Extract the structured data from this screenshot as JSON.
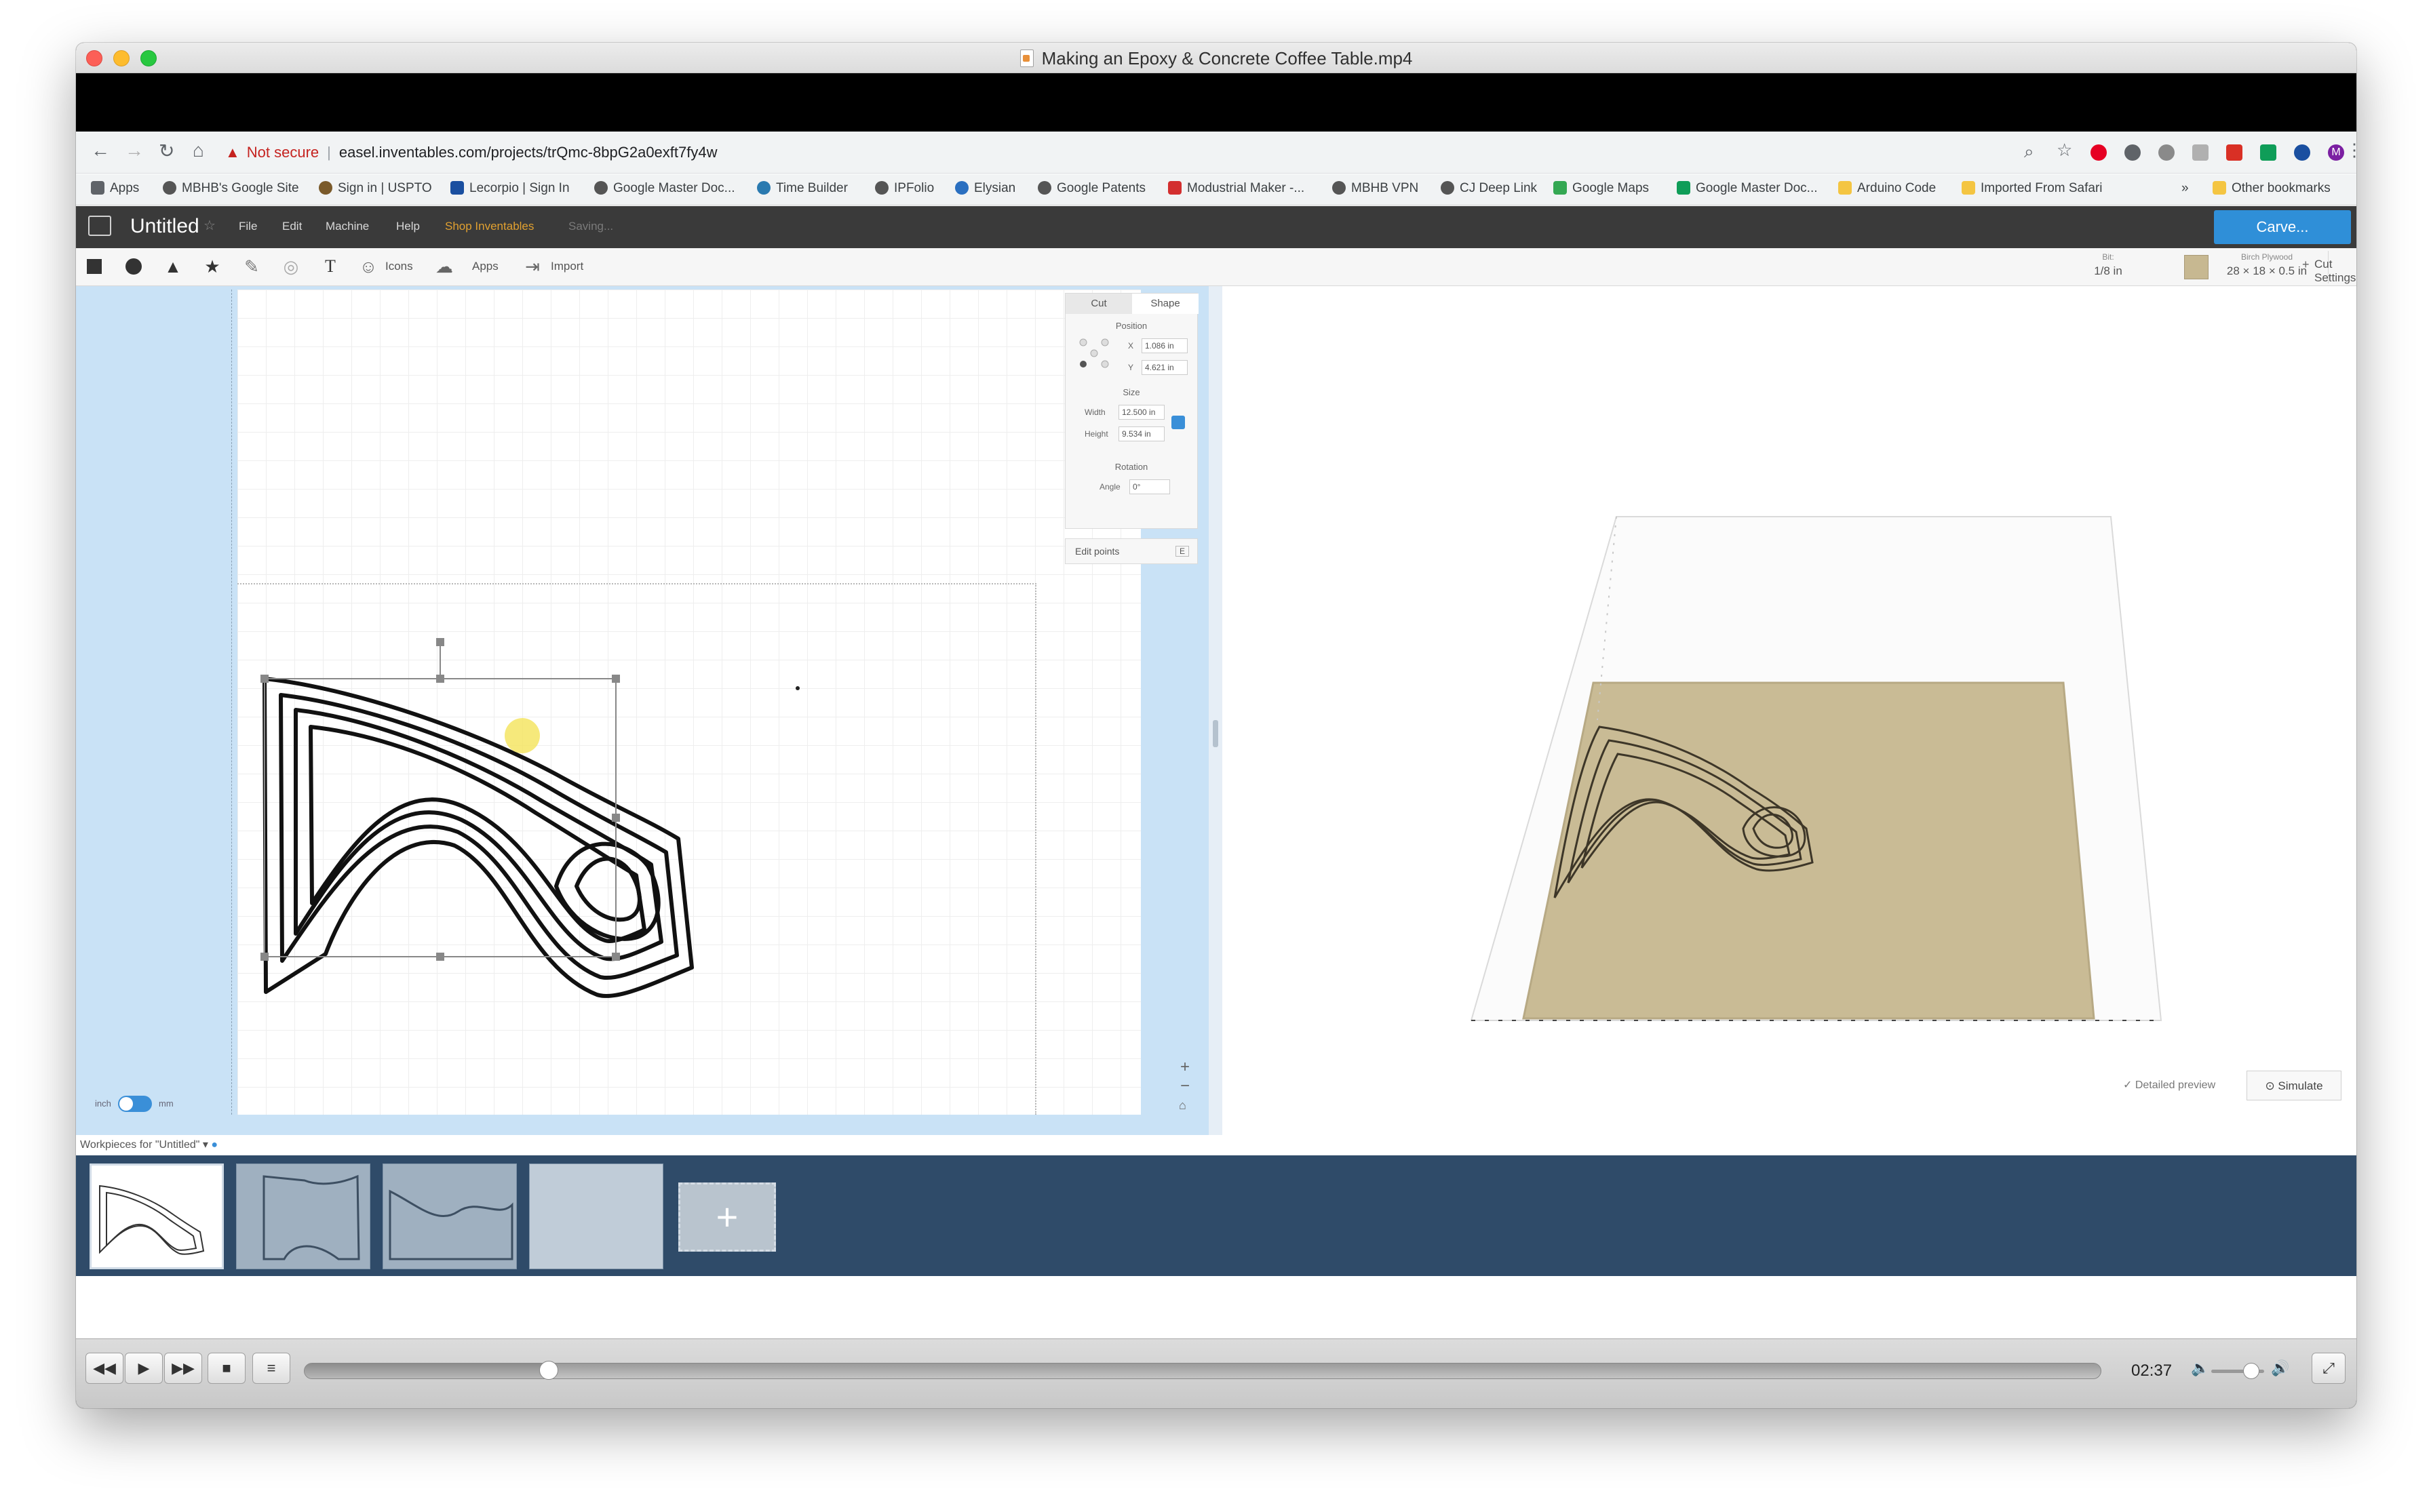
{
  "window": {
    "title": "Making an Epoxy & Concrete Coffee Table.mp4"
  },
  "browser": {
    "security": "Not secure",
    "url": "easel.inventables.com/projects/trQmc-8bpG2a0exft7fy4w",
    "bookmarks": [
      {
        "label": "Apps",
        "color": "#5f6368"
      },
      {
        "label": "MBHB's Google Site",
        "color": "#555555"
      },
      {
        "label": "Sign in | USPTO",
        "color": "#7a5a2a"
      },
      {
        "label": "Lecorpio | Sign In",
        "color": "#1a4fa0"
      },
      {
        "label": "Google Master Doc...",
        "color": "#555555"
      },
      {
        "label": "Time Builder",
        "color": "#2a7ab0"
      },
      {
        "label": "IPFolio",
        "color": "#555555"
      },
      {
        "label": "Elysian",
        "color": "#2a6fc0"
      },
      {
        "label": "Google Patents",
        "color": "#555555"
      },
      {
        "label": "Modustrial Maker -...",
        "color": "#d32f2f"
      },
      {
        "label": "MBHB VPN",
        "color": "#555555"
      },
      {
        "label": "CJ Deep Link",
        "color": "#555555"
      },
      {
        "label": "Google Maps",
        "color": "#34a853"
      },
      {
        "label": "Google Master Doc...",
        "color": "#0f9d58"
      },
      {
        "label": "Arduino Code",
        "color": "#f4c542"
      },
      {
        "label": "Imported From Safari",
        "color": "#f4c542"
      }
    ],
    "more": "»",
    "other_bookmarks": "Other bookmarks"
  },
  "easel": {
    "title": "Untitled",
    "menu": [
      "File",
      "Edit",
      "Machine",
      "Help",
      "Shop Inventables",
      "Saving..."
    ],
    "carve": "Carve...",
    "tools": {
      "icons": "Icons",
      "apps": "Apps",
      "import": "Import"
    },
    "material": {
      "name": "Birch Plywood",
      "size": "28 × 18 × 0.5 in"
    },
    "bit": {
      "label": "Bit:",
      "value": "1/8 in"
    },
    "cut_settings": "Cut Settings",
    "shape_panel": {
      "tab_cut": "Cut",
      "tab_shape": "Shape",
      "position": "Position",
      "x_label": "X",
      "x_value": "1.086 in",
      "y_label": "Y",
      "y_value": "4.621 in",
      "size": "Size",
      "width_label": "Width",
      "width_value": "12.500 in",
      "height_label": "Height",
      "height_value": "9.534 in",
      "rotation": "Rotation",
      "angle_label": "Angle",
      "angle_value": "0°",
      "edit_points": "Edit points",
      "edit_points_key": "E"
    },
    "unit_inch": "inch",
    "unit_mm": "mm",
    "detailed_preview": "✓ Detailed preview",
    "simulate": "Simulate",
    "workpieces_label": "Workpieces for \"Untitled\" ▾",
    "add_workpiece": "+"
  },
  "player": {
    "time": "02:37",
    "progress": 0.136,
    "volume": 0.75
  }
}
